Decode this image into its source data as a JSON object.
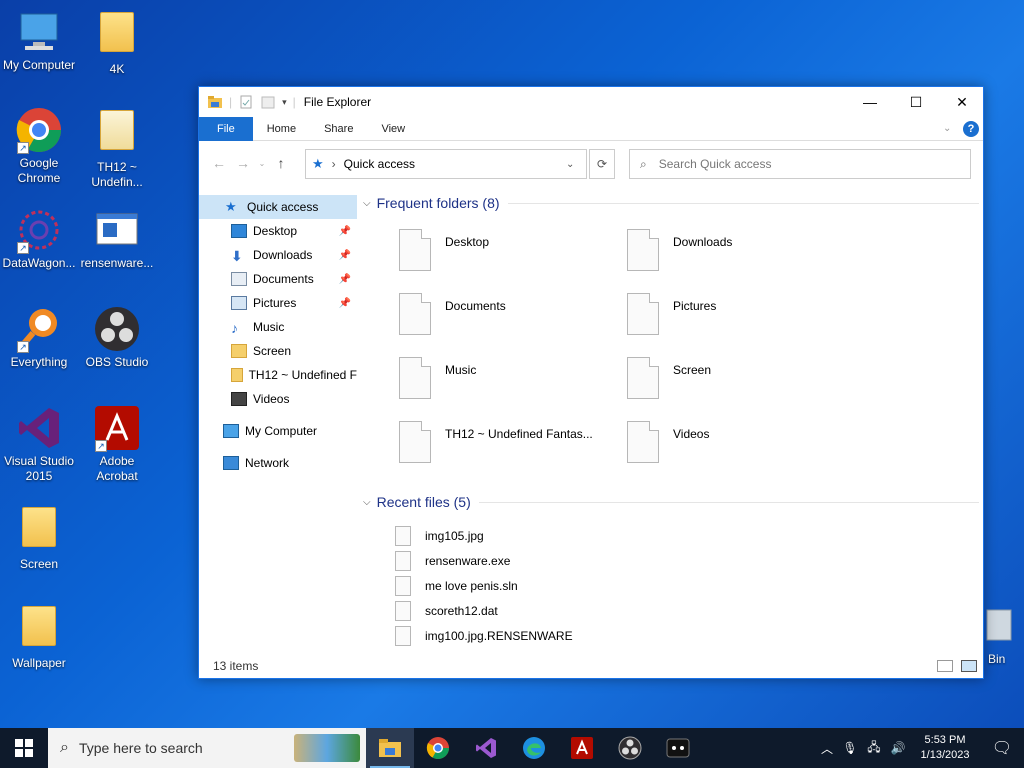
{
  "desktop": {
    "icons": [
      {
        "label": "My Computer"
      },
      {
        "label": "4K"
      },
      {
        "label": "Google Chrome"
      },
      {
        "label": "TH12 ~ Undefin..."
      },
      {
        "label": "DataWagon..."
      },
      {
        "label": "rensenware..."
      },
      {
        "label": "Everything"
      },
      {
        "label": "OBS Studio"
      },
      {
        "label": "Visual Studio 2015"
      },
      {
        "label": "Adobe Acrobat"
      },
      {
        "label": "Screen"
      },
      {
        "label": "Wallpaper"
      },
      {
        "label": "Bin"
      }
    ]
  },
  "window": {
    "title": "File Explorer",
    "ribbon_tabs": [
      "File",
      "Home",
      "Share",
      "View"
    ],
    "address": "Quick access",
    "search_placeholder": "Search Quick access",
    "nav": [
      {
        "label": "Quick access",
        "icon": "star-icon",
        "pinned": false
      },
      {
        "label": "Desktop",
        "icon": "desktop-icon",
        "pinned": true
      },
      {
        "label": "Downloads",
        "icon": "download-arrow-icon",
        "pinned": true
      },
      {
        "label": "Documents",
        "icon": "documents-icon",
        "pinned": true
      },
      {
        "label": "Pictures",
        "icon": "pictures-icon",
        "pinned": true
      },
      {
        "label": "Music",
        "icon": "music-note-icon",
        "pinned": false
      },
      {
        "label": "Screen",
        "icon": "folder-icon",
        "pinned": false
      },
      {
        "label": "TH12 ~ Undefined F",
        "icon": "folder-icon",
        "pinned": false
      },
      {
        "label": "Videos",
        "icon": "videos-icon",
        "pinned": false
      },
      {
        "label": "My Computer",
        "icon": "computer-icon",
        "pinned": false
      },
      {
        "label": "Network",
        "icon": "network-icon",
        "pinned": false
      }
    ],
    "frequent_header": "Frequent folders (8)",
    "frequent": [
      "Desktop",
      "Downloads",
      "Documents",
      "Pictures",
      "Music",
      "Screen",
      "TH12 ~ Undefined Fantas...",
      "Videos"
    ],
    "recent_header": "Recent files (5)",
    "recent": [
      "img105.jpg",
      "rensenware.exe",
      "me love penis.sln",
      "scoreth12.dat",
      "img100.jpg.RENSENWARE"
    ],
    "status": "13 items"
  },
  "taskbar": {
    "search_placeholder": "Type here to search",
    "time": "5:53 PM",
    "date": "1/13/2023"
  },
  "colors": {
    "accent": "#1a6fd0",
    "selection": "#cce4f7",
    "taskbar": "#0e1a2b"
  }
}
